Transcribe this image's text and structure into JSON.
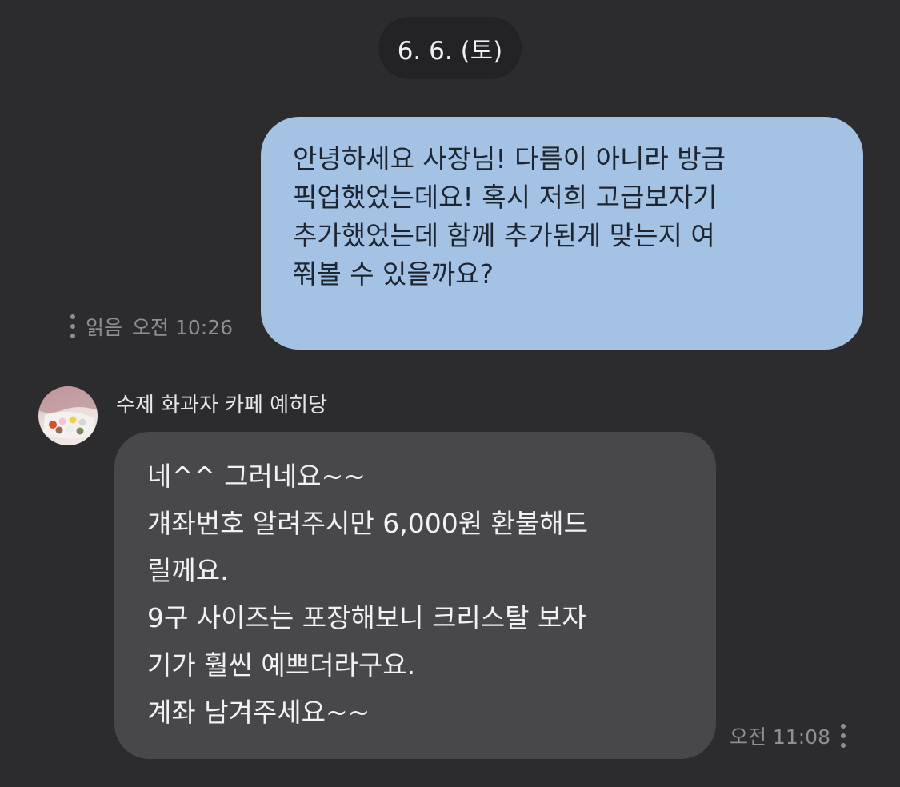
{
  "date_divider": "6. 6. (토)",
  "messages": [
    {
      "direction": "outgoing",
      "text": "안녕하세요 사장님! 다름이 아니라 방금\n픽업했었는데요! 혹시 저희 고급보자기\n추가했었는데 함께 추가된게 맞는지 여\n쭤볼 수 있을까요?",
      "read_status": "읽음",
      "time": "오전 10:26"
    },
    {
      "direction": "incoming",
      "sender": "수제 화과자 카페 예히당",
      "text": "네^^ 그러네요~~\n걔좌번호 알려주시만 6,000원 환불해드\n릴께요.\n9구 사이즈는 포장해보니 크리스탈 보자\n기가 훨씬 예쁘더라구요.\n계좌 남겨주세요~~",
      "time": "오전 11:08"
    }
  ],
  "colors": {
    "background": "#2c2c2e",
    "outgoing_bubble": "#a4c2e4",
    "incoming_bubble": "#48484c",
    "date_pill": "#232325",
    "meta_text": "#8e8e93"
  },
  "icons": {
    "more": "kebab-menu-icon",
    "avatar": "shop-avatar-image"
  }
}
